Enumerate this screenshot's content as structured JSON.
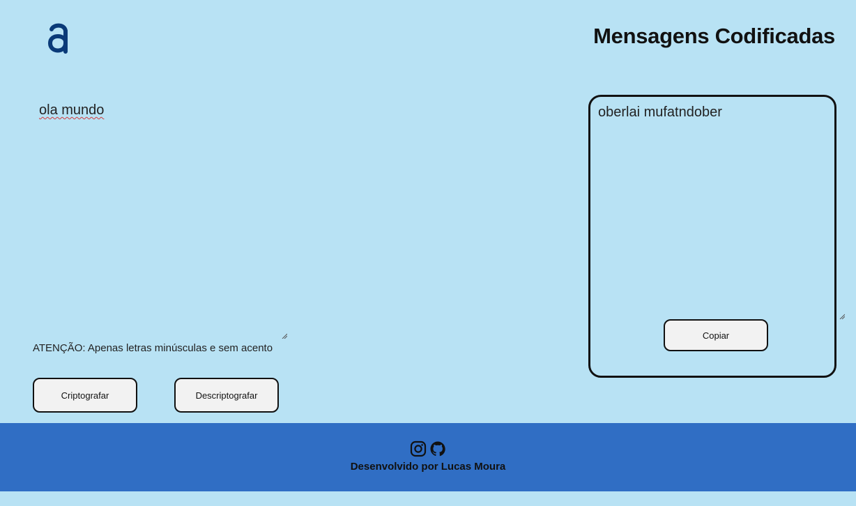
{
  "header": {
    "logo_icon": "alura-a-logo-icon",
    "title": "Mensagens Codificadas"
  },
  "input": {
    "value": "ola mundo"
  },
  "warning": "ATENÇÃO: Apenas letras minúsculas e sem acento",
  "buttons": {
    "encrypt": "Criptografar",
    "decrypt": "Descriptografar",
    "copy": "Copiar"
  },
  "output": {
    "value": "oberlai mufatndober"
  },
  "footer": {
    "icons": [
      "instagram-icon",
      "github-icon"
    ],
    "credit": "Desenvolvido por Lucas Moura"
  },
  "colors": {
    "background": "#b8e2f4",
    "footer": "#306ec4",
    "logo": "#0a3a78"
  }
}
